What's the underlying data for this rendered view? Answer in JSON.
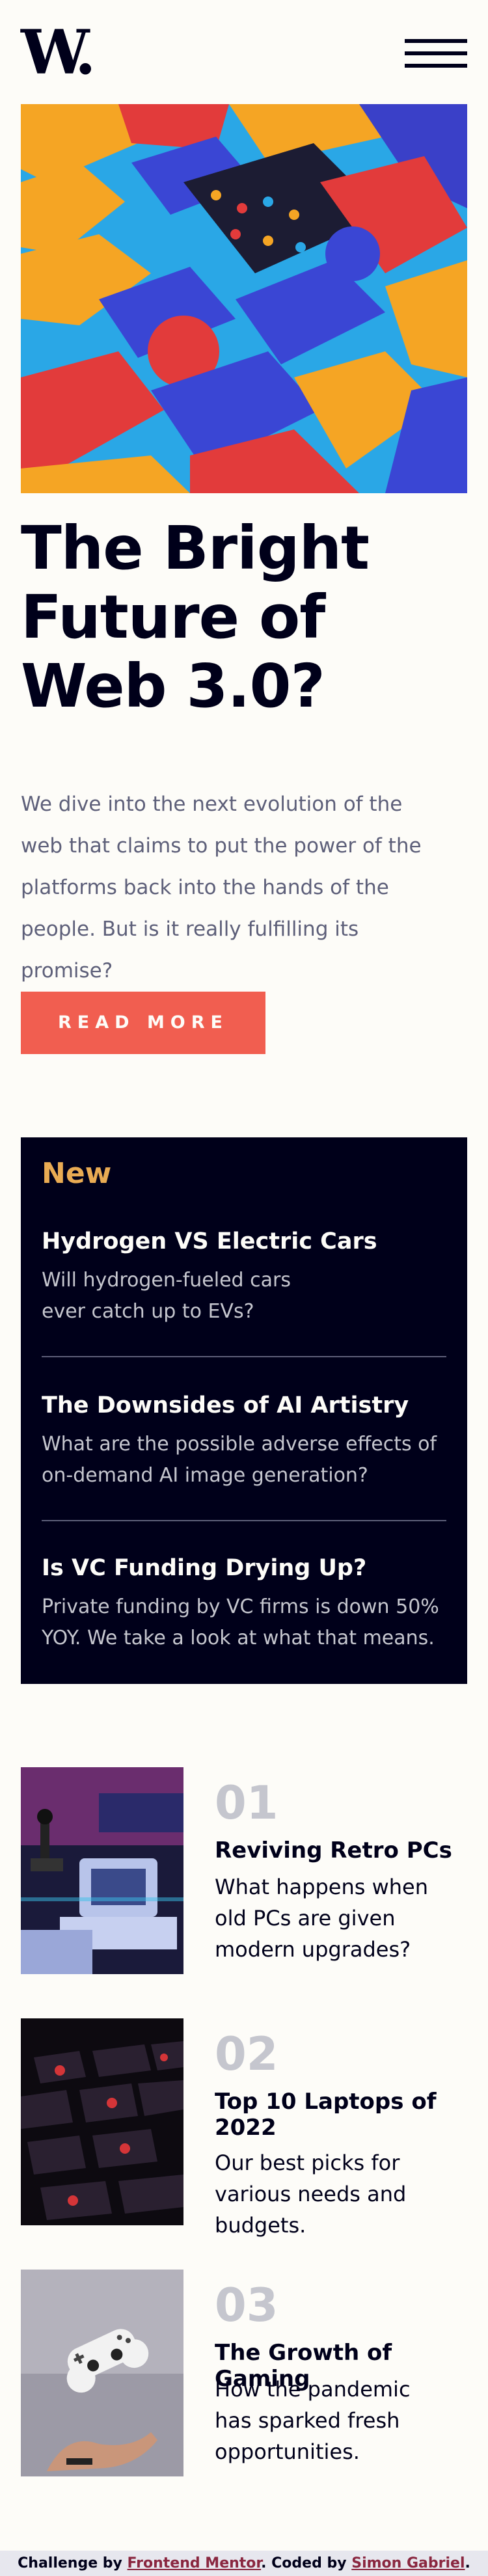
{
  "header": {
    "logo": "W.",
    "menu_icon": "hamburger-menu-icon"
  },
  "hero": {
    "image_icon": "abstract-3d-shapes-image",
    "title": "The Bright Future of Web 3.0?",
    "text": "We dive into the next evolution of the web that claims to put the power of the platforms back into the hands of the people. But is it really fulfilling its promise?",
    "button_label": "READ MORE"
  },
  "new_panel": {
    "heading": "New",
    "items": [
      {
        "title": "Hydrogen VS Electric Cars",
        "text": "Will hydrogen-fueled cars ever catch up to EVs?"
      },
      {
        "title": "The Downsides of AI Artistry",
        "text": "What are the possible adverse effects of on-demand AI image generation?"
      },
      {
        "title": "Is VC Funding Drying Up?",
        "text": "Private funding by VC firms is down 50% YOY. We take a look at what that means."
      }
    ]
  },
  "articles": [
    {
      "number": "01",
      "title": "Reviving Retro PCs",
      "text": "What happens when old PCs are given modern upgrades?",
      "image_icon": "retro-pc-image"
    },
    {
      "number": "02",
      "title": "Top 10 Laptops of 2022",
      "text": "Our best picks for various needs and budgets.",
      "image_icon": "laptop-keyboard-image"
    },
    {
      "number": "03",
      "title": "The Growth of Gaming",
      "text": "How the pandemic has sparked fresh opportunities.",
      "image_icon": "game-controller-image"
    }
  ],
  "attribution": {
    "prefix": "Challenge by ",
    "link1": "Frontend Mentor",
    "middle": ". Coded by ",
    "link2": "Simon Gabriel",
    "suffix": "."
  },
  "colors": {
    "background": "#fdfcf8",
    "dark": "#00001a",
    "accent_red": "#f15e50",
    "accent_orange": "#e9ab53",
    "grayish_blue": "#5d5f79",
    "light_gray": "#c5c6ce"
  }
}
